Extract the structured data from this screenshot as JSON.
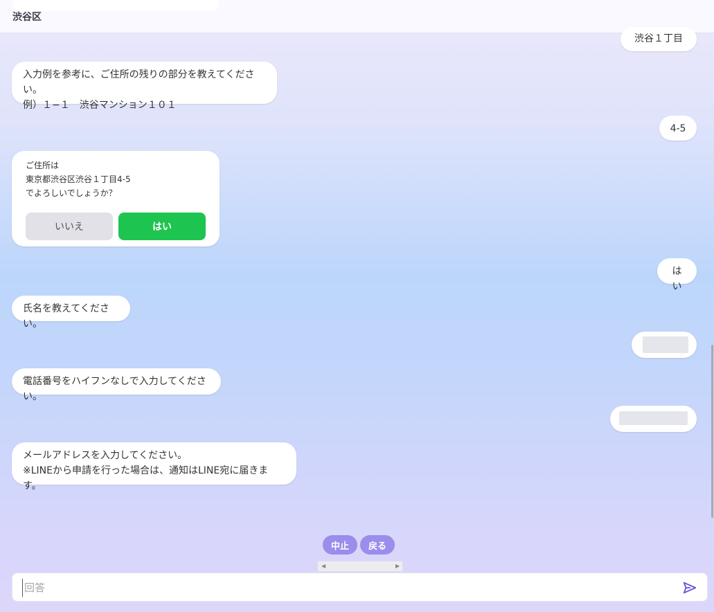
{
  "header": {
    "title": "渋谷区"
  },
  "messages": {
    "user_shibuya": "渋谷１丁目",
    "bot_address_prompt": "入力例を参考に、ご住所の残りの部分を教えてください。\n例）１−１　渋谷マンション１０１",
    "user_45": "4-5",
    "confirm": {
      "text": "ご住所は\n東京都渋谷区渋谷１丁目4-5\nでよろしいでしょうか？",
      "no_label": "いいえ",
      "yes_label": "はい"
    },
    "user_yes": "はい",
    "bot_name_prompt": "氏名を教えてください。",
    "bot_phone_prompt": "電話番号をハイフンなしで入力してください。",
    "bot_email_prompt": "メールアドレスを入力してください。\n※LINEから申請を行った場合は、通知はLINE宛に届きます。"
  },
  "controls": {
    "stop_label": "中止",
    "back_label": "戻る"
  },
  "input": {
    "placeholder": "回答",
    "value": ""
  },
  "icons": {
    "send": "send-icon",
    "scroll_left": "chevron-left-icon",
    "scroll_right": "chevron-right-icon"
  },
  "colors": {
    "accent": "#9b8deb",
    "yes_button": "#1ec450",
    "send_icon": "#6a4fd8"
  }
}
